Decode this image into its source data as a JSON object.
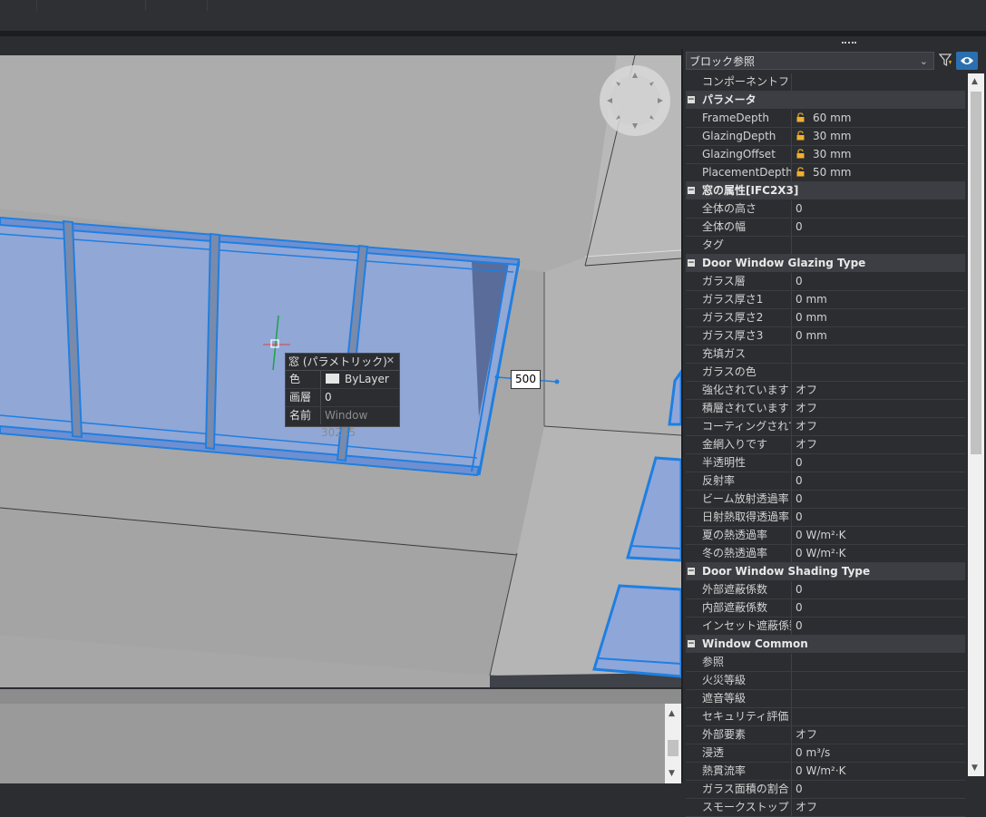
{
  "topbar": {
    "items": [
      "",
      "",
      "",
      "",
      ""
    ]
  },
  "viewport": {
    "dimension_value": "500",
    "quad": {
      "title": "窓 (パラメトリック)",
      "rows": [
        {
          "key": "色",
          "value": "ByLayer"
        },
        {
          "key": "画層",
          "value": "0"
        },
        {
          "key": "名前",
          "value": "Window 30245"
        }
      ]
    }
  },
  "panel": {
    "selector": "ブロック参照",
    "rows": [
      {
        "type": "prop",
        "key": "コンポーネントファイル",
        "value": ""
      },
      {
        "type": "cat",
        "label": "パラメータ"
      },
      {
        "type": "prop",
        "key": "FrameDepth",
        "value": "60 mm",
        "locked": true
      },
      {
        "type": "prop",
        "key": "GlazingDepth",
        "value": "30 mm",
        "locked": true
      },
      {
        "type": "prop",
        "key": "GlazingOffset",
        "value": "30 mm",
        "locked": true
      },
      {
        "type": "prop",
        "key": "PlacementDepth",
        "value": "50 mm",
        "locked": true
      },
      {
        "type": "cat",
        "label": "窓の属性[IFC2X3]"
      },
      {
        "type": "prop",
        "key": "全体の高さ",
        "value": "0"
      },
      {
        "type": "prop",
        "key": "全体の幅",
        "value": "0"
      },
      {
        "type": "prop",
        "key": "タグ",
        "value": ""
      },
      {
        "type": "cat",
        "label": "Door Window Glazing Type"
      },
      {
        "type": "prop",
        "key": "ガラス層",
        "value": "0"
      },
      {
        "type": "prop",
        "key": "ガラス厚さ1",
        "value": "0 mm"
      },
      {
        "type": "prop",
        "key": "ガラス厚さ2",
        "value": "0 mm"
      },
      {
        "type": "prop",
        "key": "ガラス厚さ3",
        "value": "0 mm"
      },
      {
        "type": "prop",
        "key": "充填ガス",
        "value": ""
      },
      {
        "type": "prop",
        "key": "ガラスの色",
        "value": ""
      },
      {
        "type": "prop",
        "key": "強化されています",
        "value": "オフ"
      },
      {
        "type": "prop",
        "key": "積層されています",
        "value": "オフ"
      },
      {
        "type": "prop",
        "key": "コーティングされています",
        "value": "オフ"
      },
      {
        "type": "prop",
        "key": "金網入りです",
        "value": "オフ"
      },
      {
        "type": "prop",
        "key": "半透明性",
        "value": "0"
      },
      {
        "type": "prop",
        "key": "反射率",
        "value": "0"
      },
      {
        "type": "prop",
        "key": "ビーム放射透過率",
        "value": "0"
      },
      {
        "type": "prop",
        "key": "日射熱取得透過率",
        "value": "0"
      },
      {
        "type": "prop",
        "key": "夏の熱透過率",
        "value": "0 W/m²·K"
      },
      {
        "type": "prop",
        "key": "冬の熱透過率",
        "value": "0 W/m²·K"
      },
      {
        "type": "cat",
        "label": "Door Window Shading Type"
      },
      {
        "type": "prop",
        "key": "外部遮蔽係数",
        "value": "0"
      },
      {
        "type": "prop",
        "key": "内部遮蔽係数",
        "value": "0"
      },
      {
        "type": "prop",
        "key": "インセット遮蔽係数",
        "value": "0"
      },
      {
        "type": "cat",
        "label": "Window Common"
      },
      {
        "type": "prop",
        "key": "参照",
        "value": ""
      },
      {
        "type": "prop",
        "key": "火災等級",
        "value": ""
      },
      {
        "type": "prop",
        "key": "遮音等級",
        "value": ""
      },
      {
        "type": "prop",
        "key": "セキュリティ評価",
        "value": ""
      },
      {
        "type": "prop",
        "key": "外部要素",
        "value": "オフ"
      },
      {
        "type": "prop",
        "key": "浸透",
        "value": "0 m³/s"
      },
      {
        "type": "prop",
        "key": "熱貫流率",
        "value": "0 W/m²·K"
      },
      {
        "type": "prop",
        "key": "ガラス面積の割合",
        "value": "0"
      },
      {
        "type": "prop",
        "key": "スモークストップ",
        "value": "オフ"
      }
    ]
  },
  "colors": {
    "accent": "#2a6fb0",
    "selection": "#1f7fe0",
    "glass": "#8fa6d8"
  }
}
